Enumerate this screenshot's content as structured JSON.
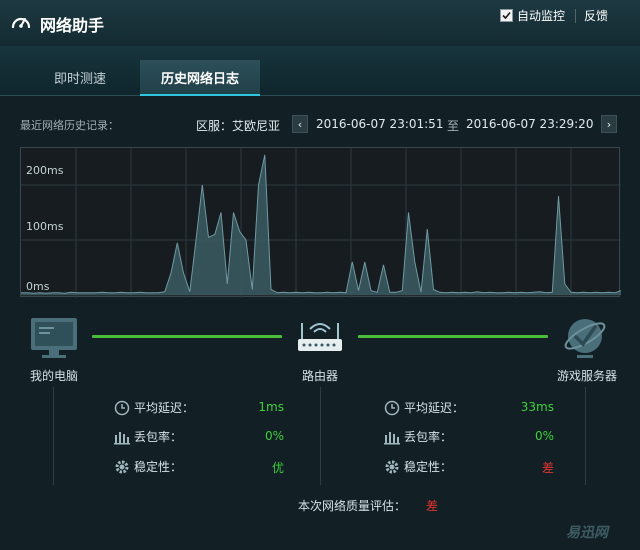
{
  "app": {
    "title": "网络助手"
  },
  "header": {
    "auto_monitor_label": "自动监控",
    "auto_monitor_checked": true,
    "feedback_label": "反馈"
  },
  "tabs": [
    {
      "label": "即时测速",
      "active": false
    },
    {
      "label": "历史网络日志",
      "active": true
    }
  ],
  "history": {
    "label": "最近网络历史记录：",
    "server": "区服：艾欧尼亚",
    "start": "2016-06-07 23:01:51",
    "to": "至",
    "end": "2016-06-07 23:29:20"
  },
  "chart_data": {
    "type": "area",
    "ylabels": [
      "200ms",
      "100ms",
      "0ms"
    ],
    "ylim": [
      0,
      260
    ],
    "values": [
      4,
      4,
      3,
      4,
      3,
      4,
      4,
      3,
      5,
      4,
      4,
      4,
      4,
      5,
      4,
      4,
      5,
      4,
      4,
      5,
      4,
      4,
      4,
      6,
      40,
      95,
      40,
      6,
      100,
      200,
      105,
      110,
      150,
      20,
      150,
      115,
      100,
      10,
      200,
      255,
      10,
      4,
      5,
      4,
      5,
      4,
      5,
      4,
      4,
      5,
      4,
      5,
      4,
      60,
      8,
      60,
      8,
      5,
      55,
      5,
      5,
      8,
      150,
      60,
      5,
      120,
      10,
      5,
      4,
      5,
      4,
      5,
      4,
      6,
      4,
      5,
      4,
      4,
      5,
      4,
      5,
      4,
      5,
      6,
      4,
      5,
      180,
      20,
      5,
      4,
      5,
      4,
      5,
      4,
      5,
      4,
      8
    ]
  },
  "nodes": {
    "pc": "我的电脑",
    "router": "路由器",
    "server": "游戏服务器"
  },
  "stats_left": {
    "latency_label": "平均延迟：",
    "latency_value": "1ms",
    "loss_label": "丢包率：",
    "loss_value": "0%",
    "stability_label": "稳定性：",
    "stability_value": "优"
  },
  "stats_right": {
    "latency_label": "平均延迟：",
    "latency_value": "33ms",
    "loss_label": "丢包率：",
    "loss_value": "0%",
    "stability_label": "稳定性：",
    "stability_value": "差"
  },
  "evaluation": {
    "label": "本次网络质量评估：",
    "value": "差"
  },
  "watermark": "易迅网",
  "colors": {
    "accent": "#2fc6e0",
    "good": "#3fcf3b",
    "bad": "#e0332c",
    "link": "#4cbd3a"
  }
}
